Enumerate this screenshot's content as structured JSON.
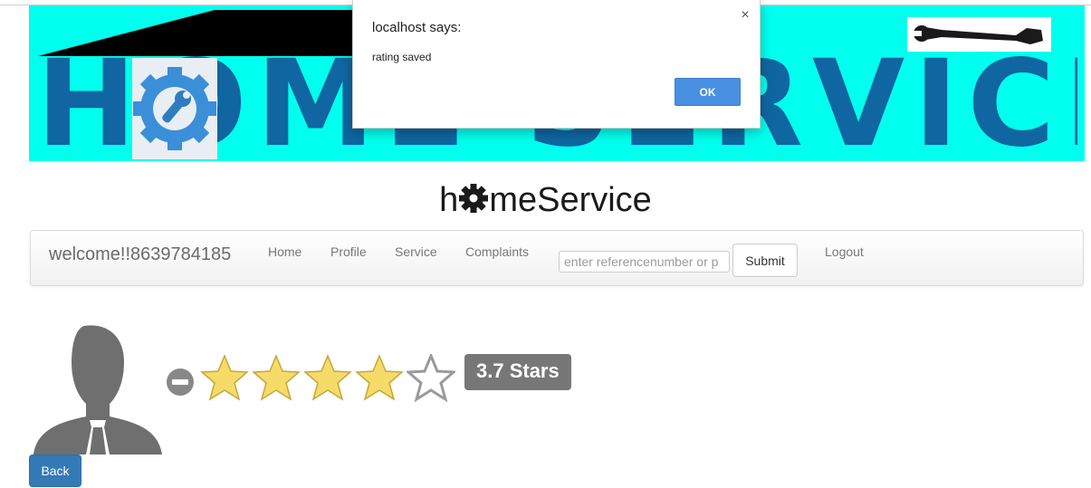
{
  "banner": {
    "text": "HOME SERVICES"
  },
  "brand": {
    "prefix": "h",
    "suffix": "meService"
  },
  "navbar": {
    "welcome": "welcome!!8639784185",
    "links": [
      "Home",
      "Profile",
      "Service",
      "Complaints",
      "Logout"
    ],
    "search_placeholder": "enter referencenumber or p",
    "submit_label": "Submit"
  },
  "rating": {
    "value": 3.7,
    "max": 5,
    "label": "3.7 Stars",
    "star_color": "#f5dc6a",
    "empty_star_color": "#9a9a9a"
  },
  "back_label": "Back",
  "dialog": {
    "title": "localhost says:",
    "message": "rating saved",
    "close_symbol": "×",
    "ok_label": "OK"
  },
  "icons": {
    "gear": "gear-icon",
    "wrench": "wrench-icon",
    "avatar": "user-silhouette-icon",
    "clear": "minus-circle-icon",
    "star": "star-icon"
  }
}
